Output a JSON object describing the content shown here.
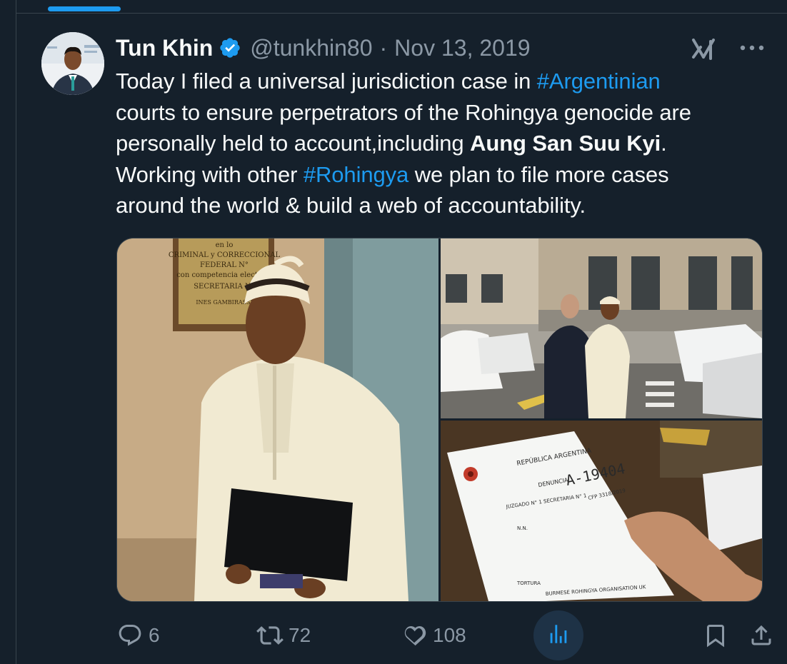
{
  "tweet": {
    "author_name": "Tun Khin",
    "handle": "@tunkhin80",
    "separator": "·",
    "date": "Nov 13, 2019",
    "text_line1_a": "Today I filed a universal jurisdiction case in ",
    "hashtag_1": "#Argentinian",
    "text_line2": "courts to ensure perpetrators of the Rohingya genocide are",
    "text_line3_a": "personally held to account,including ",
    "text_bold": "Aung San Suu Kyi",
    "text_line3_b": ".",
    "text_line4_a": "Working with other ",
    "hashtag_2": "#Rohingya",
    "text_line4_b": " we plan to file more cases",
    "text_line5": "around the world & build a web of accountability."
  },
  "media": {
    "photo1_plaque_lines": [
      "en lo",
      "CRIMINAL y CORRECCIONAL",
      "FEDERAL N°",
      "con competencia electoral",
      "SECRETARIA N°",
      "INES GAMBIRASSI"
    ],
    "photo3_doc_header": "REPÚBLICA ARGENTINA",
    "photo3_doc_title": "DENUNCIA",
    "photo3_doc_number": "A-19404",
    "photo3_doc_ref": "CFP 3318/2019",
    "photo3_doc_line": "JUZGADO N° 1 SECRETARIA N° 1",
    "photo3_doc_nn": "N.N.",
    "photo3_doc_footer1": "TORTURA",
    "photo3_doc_footer2": "BURMESE ROHINGYA ORGANISATION UK"
  },
  "actions": {
    "replies": "6",
    "retweets": "72",
    "likes": "108"
  },
  "icons": {
    "verified": "verified-badge-icon",
    "grok": "grok-icon",
    "more": "more-icon",
    "reply": "reply-icon",
    "retweet": "retweet-icon",
    "like": "like-icon",
    "views": "views-icon",
    "bookmark": "bookmark-icon",
    "share": "share-icon"
  },
  "colors": {
    "background": "#15202b",
    "accent": "#1d9bf0",
    "muted": "#8b98a5",
    "text": "#f7f9f9"
  }
}
